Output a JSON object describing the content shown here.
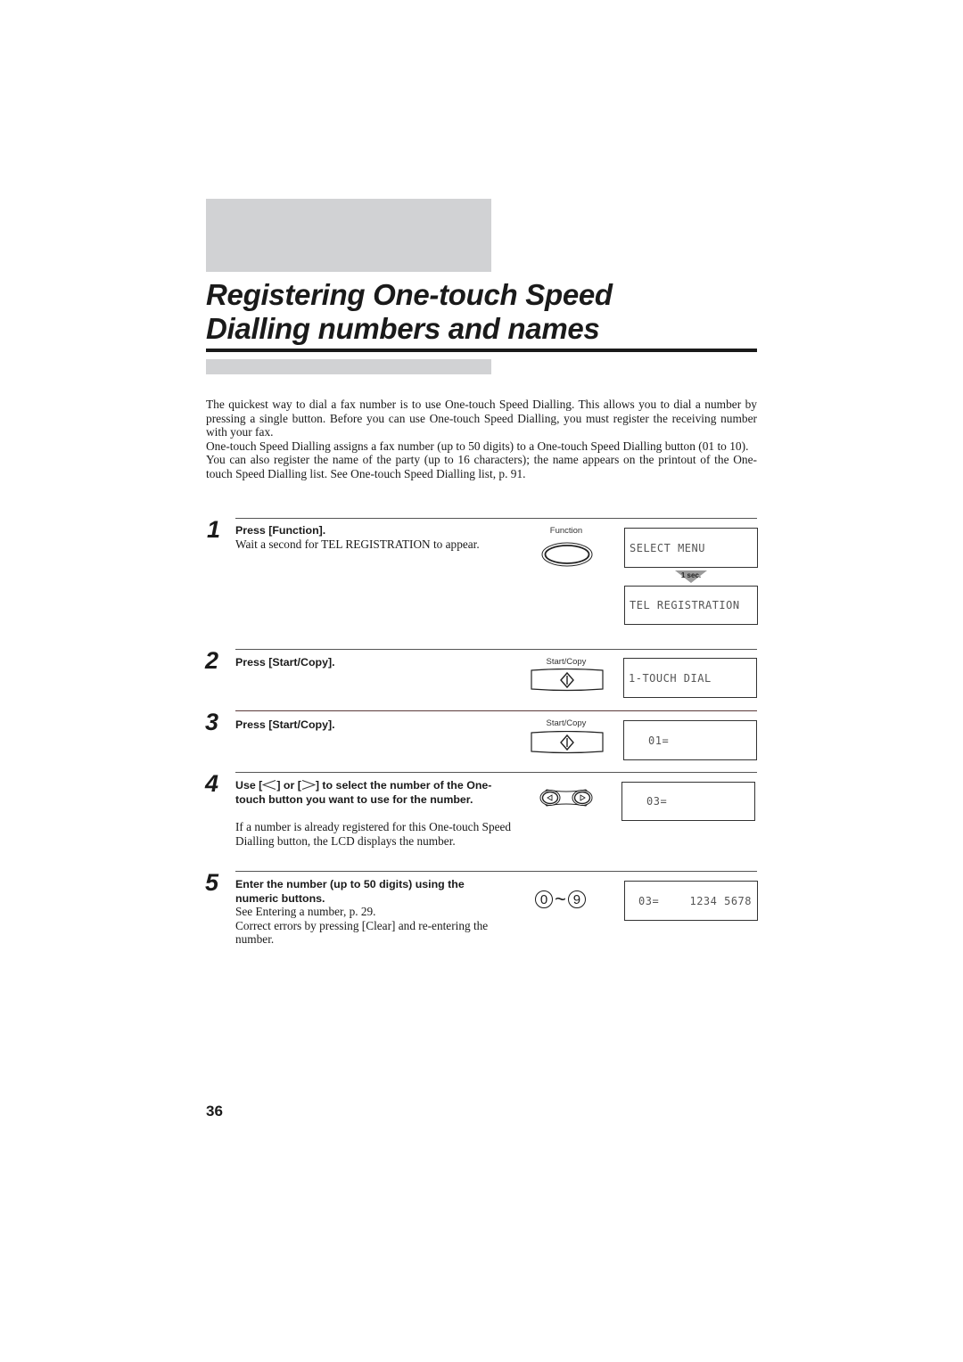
{
  "page": {
    "title_line1": "Registering One-touch Speed",
    "title_line2": "Dialling numbers and names",
    "page_number": "36"
  },
  "intro": {
    "paragraphs": [
      "The quickest way to dial a fax number is to use One-touch Speed Dialling. This allows you to dial a number by pressing a single button. Before you can use One-touch Speed Dialling, you must register the receiving number with your fax.",
      "One-touch Speed Dialling assigns a fax number (up to 50 digits) to a One-touch Speed Dialling button (01 to 10).",
      "You can also register the name of the party (up to 16 characters); the name appears on the printout of the One-touch Speed Dialling list. See One-touch Speed Dialling list, p. 91."
    ]
  },
  "steps": [
    {
      "number": "1",
      "heading": "Press [Function].",
      "body": "Wait a second for TEL REGISTRATION to appear.",
      "button_label": "Function",
      "button_icon": "oval-function-button-icon",
      "lcd": [
        "SELECT MENU",
        "TEL REGISTRATION"
      ],
      "transition_label": "1 sec."
    },
    {
      "number": "2",
      "heading": "Press [Start/Copy].",
      "button_label": "Start/Copy",
      "button_icon": "start-copy-diamond-icon",
      "lcd": [
        "1-TOUCH DIAL"
      ]
    },
    {
      "number": "3",
      "heading": "Press [Start/Copy].",
      "button_label": "Start/Copy",
      "button_icon": "start-copy-diamond-icon",
      "lcd": [
        "01="
      ]
    },
    {
      "number": "4",
      "heading_pre": "Use [",
      "heading_mid": "] or [",
      "heading_post": "] to select the number of the One-touch button you want to use for the number.",
      "body": "If a number is already registered for this One-touch Speed Dialling button, the LCD displays the number.",
      "button_icon": "left-right-arrow-buttons-icon",
      "lcd": [
        "03="
      ]
    },
    {
      "number": "5",
      "heading": "Enter the number (up to 50 digits) using the numeric buttons.",
      "body_line1": "See Entering a number, p. 29.",
      "body_line2": "Correct errors by pressing [Clear] and re-entering the number.",
      "keys_from": "0",
      "keys_sep": "~",
      "keys_to": "9",
      "lcd_left": "03=",
      "lcd_right": "1234 5678"
    }
  ]
}
